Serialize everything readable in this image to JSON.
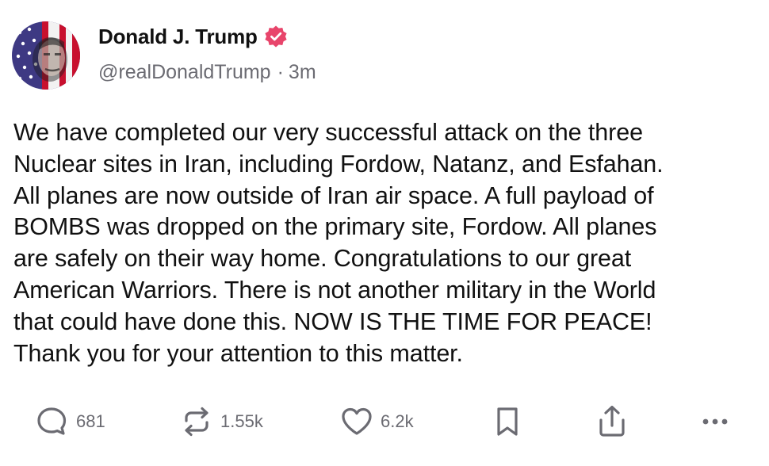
{
  "author": {
    "display_name": "Donald J. Trump",
    "handle": "@realDonaldTrump",
    "separator": "·",
    "time_ago": "3m"
  },
  "post": {
    "lines": [
      "We have completed our very successful attack on the three",
      "Nuclear sites in Iran, including Fordow, Natanz, and Esfahan.",
      "All planes are now outside of Iran air space. A full payload of",
      "BOMBS was dropped on the primary site, Fordow. All planes",
      "are safely on their way home. Congratulations to our great",
      "American Warriors. There is not another military in the World",
      "that could have done this. NOW IS THE TIME FOR PEACE!",
      "Thank you for your attention to this matter."
    ]
  },
  "actions": {
    "replies": "681",
    "reposts": "1.55k",
    "likes": "6.2k"
  },
  "icons": {
    "verified": "verified-badge-icon",
    "reply": "reply-icon",
    "repost": "repost-icon",
    "like": "heart-icon",
    "bookmark": "bookmark-icon",
    "share": "share-icon",
    "more": "more-icon"
  },
  "colors": {
    "verified_badge": "#e8456b",
    "text_primary": "#111111",
    "text_secondary": "#6b6b72"
  }
}
